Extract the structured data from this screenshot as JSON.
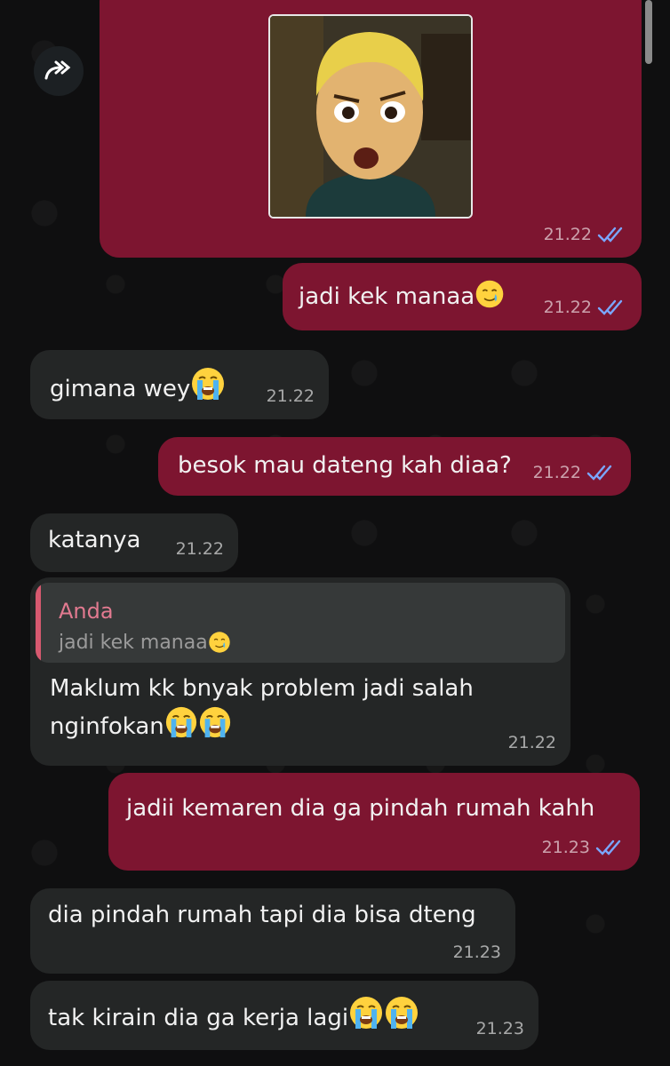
{
  "colors": {
    "outgoing_bubble": "#7d1530",
    "incoming_bubble": "#242626",
    "read_ticks": "#7aa7ff",
    "quote_accent": "#d7596f"
  },
  "icons": {
    "forward": "forward-arrow-icon",
    "read_receipt": "double-check-icon",
    "crying": "loudly-crying-face-emoji",
    "tear_smile": "smiling-face-with-tear-emoji"
  },
  "messages": [
    {
      "direction": "out",
      "type": "image",
      "image": "cartoon-avatar-sticker",
      "time": "21.22",
      "status": "read"
    },
    {
      "direction": "out",
      "text": "jadi kek manaa",
      "emoji": "smiling-face-with-tear",
      "time": "21.22",
      "status": "read"
    },
    {
      "direction": "in",
      "text": "gimana wey",
      "emoji": "loudly-crying-face",
      "time": "21.22"
    },
    {
      "direction": "out",
      "text": "besok mau dateng kah diaa?",
      "time": "21.22",
      "status": "read"
    },
    {
      "direction": "in",
      "text": "katanya",
      "time": "21.22"
    },
    {
      "direction": "in",
      "reply_to": {
        "sender": "Anda",
        "text": "jadi kek manaa"
      },
      "text_line1": "Maklum kk bnyak problem jadi salah",
      "text_line2": "nginfokan",
      "time": "21.22"
    },
    {
      "direction": "out",
      "text": "jadii kemaren dia ga pindah rumah kahh",
      "time": "21.23",
      "status": "read"
    },
    {
      "direction": "in",
      "text": "dia pindah rumah tapi dia bisa dteng",
      "time": "21.23"
    },
    {
      "direction": "in",
      "text": "tak kirain dia ga kerja lagi",
      "time": "21.23"
    }
  ]
}
